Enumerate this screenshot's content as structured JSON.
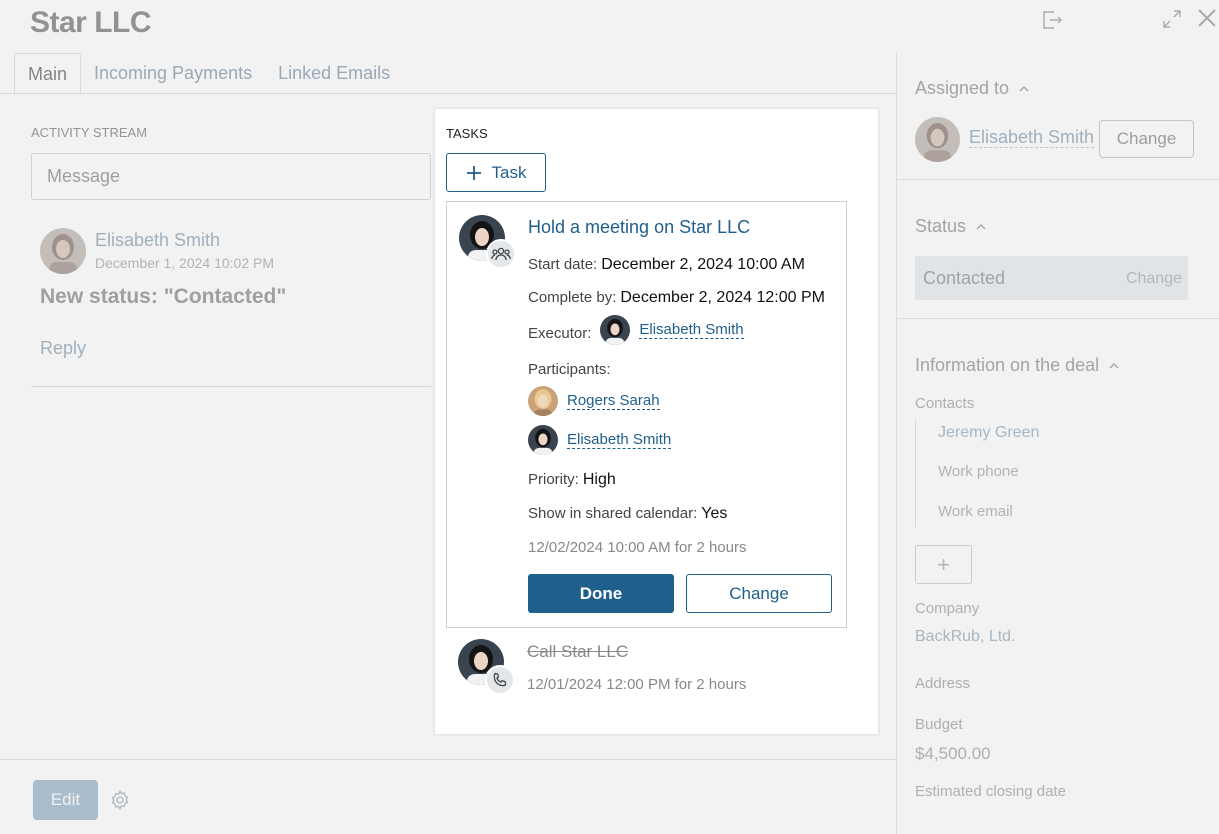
{
  "header": {
    "title": "Star LLC",
    "icons": [
      "exit-icon",
      "expand-icon",
      "close-icon"
    ]
  },
  "tabs": [
    {
      "label": "Main",
      "active": true
    },
    {
      "label": "Incoming Payments",
      "active": false
    },
    {
      "label": "Linked Emails",
      "active": false
    }
  ],
  "activity": {
    "section_label": "ACTIVITY STREAM",
    "message_placeholder": "Message",
    "post": {
      "author": "Elisabeth Smith",
      "date": "December 1, 2024 10:02 PM",
      "text": "New status: \"Contacted\"",
      "reply_label": "Reply"
    }
  },
  "footer": {
    "edit_label": "Edit"
  },
  "sidebar": {
    "assigned": {
      "heading": "Assigned to",
      "name": "Elisabeth Smith",
      "change_label": "Change"
    },
    "status": {
      "heading": "Status",
      "value": "Contacted",
      "change_label": "Change"
    },
    "deal": {
      "heading": "Information on the deal",
      "contacts_label": "Contacts",
      "contact_name": "Jeremy Green",
      "work_phone": "Work phone",
      "work_email": "Work email",
      "add_label": "+",
      "company_label": "Company",
      "company_value": "BackRub, Ltd.",
      "address_label": "Address",
      "budget_label": "Budget",
      "budget_value": "$4,500.00",
      "closing_label": "Estimated closing date"
    }
  },
  "tasks": {
    "title": "TASKS",
    "add_label": "Task",
    "task1": {
      "title": "Hold a meeting on Star LLC",
      "start_label": "Start date:",
      "start_value": "December 2, 2024 10:00 AM",
      "complete_label": "Complete by:",
      "complete_value": "December 2, 2024 12:00 PM",
      "executor_label": "Executor:",
      "executor_name": "Elisabeth Smith",
      "participants_label": "Participants:",
      "participants": [
        "Rogers Sarah",
        "Elisabeth Smith"
      ],
      "priority_label": "Priority:",
      "priority_value": "High",
      "calendar_label": "Show in shared calendar:",
      "calendar_value": "Yes",
      "when": "12/02/2024 10:00 AM for 2 hours",
      "done_label": "Done",
      "change_label": "Change"
    },
    "task2": {
      "title": "Call Star LLC",
      "when": "12/01/2024 12:00 PM for 2 hours"
    }
  },
  "colors": {
    "accent": "#1f5f8c",
    "status_bg": "#edf1f4"
  }
}
